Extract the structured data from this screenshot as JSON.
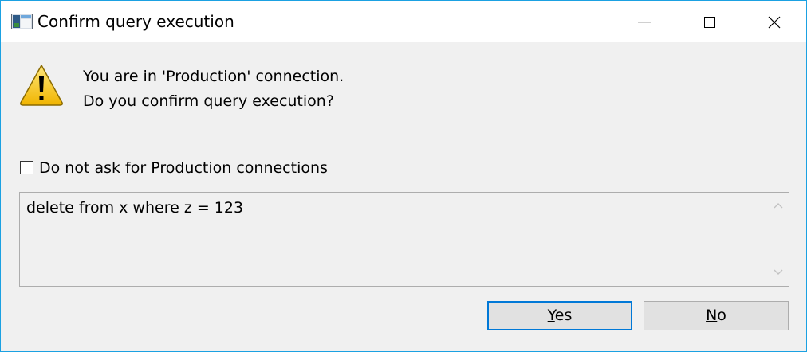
{
  "window": {
    "title": "Confirm query execution",
    "accent_color": "#1ba1e2"
  },
  "title_buttons": {
    "minimize_icon": "minimize-icon",
    "maximize_icon": "maximize-icon",
    "close_icon": "close-icon"
  },
  "message": {
    "icon": "warning-icon",
    "line1": "You are in 'Production' connection.",
    "line2": "Do you confirm query execution?"
  },
  "option": {
    "checked": false,
    "label": "Do not ask for Production connections"
  },
  "query": {
    "text": "delete from x where z = 123"
  },
  "buttons": {
    "yes": {
      "accel": "Y",
      "rest": "es",
      "default": true,
      "focus_color": "#0078d7"
    },
    "no": {
      "accel": "N",
      "rest": "o"
    }
  }
}
